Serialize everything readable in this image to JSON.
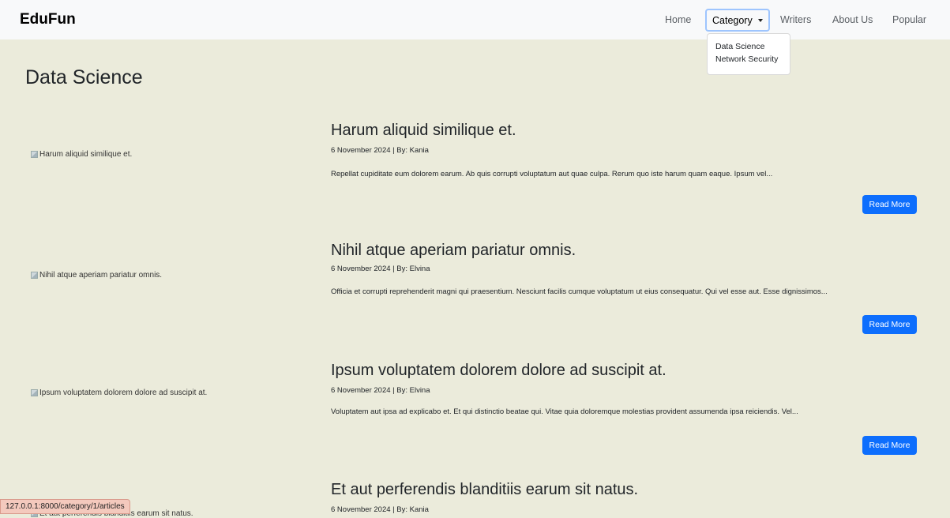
{
  "brand": "EduFun",
  "nav": {
    "home": "Home",
    "category": "Category",
    "writers": "Writers",
    "about": "About Us",
    "popular": "Popular"
  },
  "dropdown": [
    "Data Science",
    "Network Security"
  ],
  "page_title": "Data Science",
  "articles": [
    {
      "alt": "Harum aliquid similique et.",
      "title": "Harum aliquid similique et.",
      "meta": "6 November 2024 | By: Kania",
      "excerpt": "Repellat cupiditate eum dolorem earum. Ab quis corrupti voluptatum aut quae culpa. Rerum quo iste harum quam eaque. Ipsum vel...",
      "button": "Read More"
    },
    {
      "alt": "Nihil atque aperiam pariatur omnis.",
      "title": "Nihil atque aperiam pariatur omnis.",
      "meta": "6 November 2024 | By: Elvina",
      "excerpt": "Officia et corrupti reprehenderit magni qui praesentium. Nesciunt facilis cumque voluptatum ut eius consequatur. Qui vel esse aut. Esse dignissimos...",
      "button": "Read More"
    },
    {
      "alt": "Ipsum voluptatem dolorem dolore ad suscipit at.",
      "title": "Ipsum voluptatem dolorem dolore ad suscipit at.",
      "meta": "6 November 2024 | By: Elvina",
      "excerpt": "Voluptatem aut ipsa ad explicabo et. Et qui distinctio beatae qui. Vitae quia doloremque molestias provident assumenda ipsa reiciendis. Vel...",
      "button": "Read More"
    },
    {
      "alt": "Et aut perferendis blanditiis earum sit natus.",
      "title": "Et aut perferendis blanditiis earum sit natus.",
      "meta": "6 November 2024 | By: Kania",
      "excerpt": "",
      "button": ""
    }
  ],
  "status_url": "127.0.0.1:8000/category/1/articles"
}
